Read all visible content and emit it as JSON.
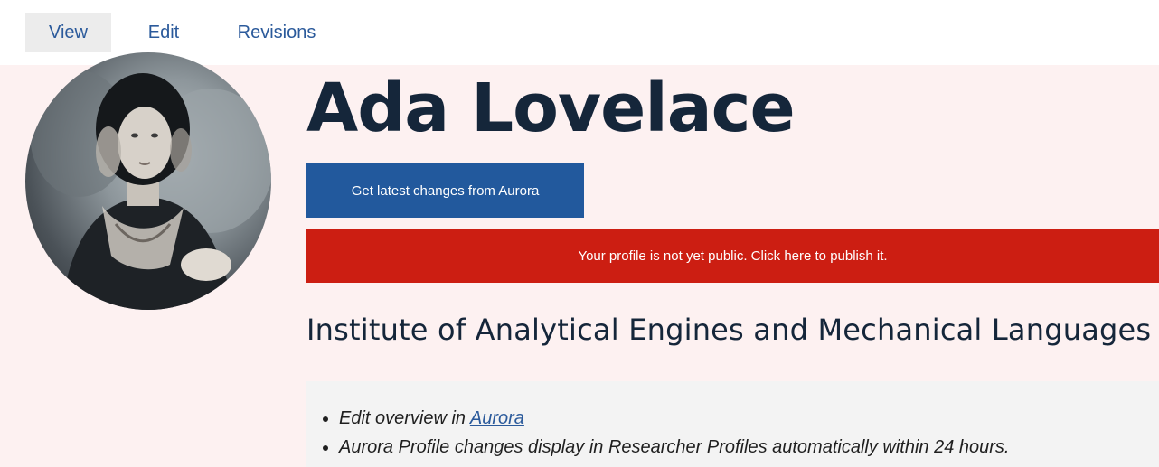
{
  "tabs": [
    {
      "label": "View",
      "active": true
    },
    {
      "label": "Edit",
      "active": false
    },
    {
      "label": "Revisions",
      "active": false
    }
  ],
  "profile": {
    "name": "Ada Lovelace",
    "portrait_alt": "Portrait of Ada Lovelace",
    "aurora_button_label": "Get latest changes from Aurora",
    "publish_banner": "Your profile is not yet public. Click here to publish it.",
    "institute": "Institute of Analytical Engines and Mechanical Languages",
    "info": {
      "item1_prefix": "Edit overview in ",
      "item1_link": "Aurora",
      "item2": "Aurora Profile changes display in Researcher Profiles automatically within 24 hours."
    }
  },
  "colors": {
    "background": "#fdf1f1",
    "primary_button": "#22599d",
    "alert_banner": "#cc1e12",
    "info_box": "#f3f3f3",
    "link": "#2b5a9b",
    "heading": "#15263a"
  }
}
